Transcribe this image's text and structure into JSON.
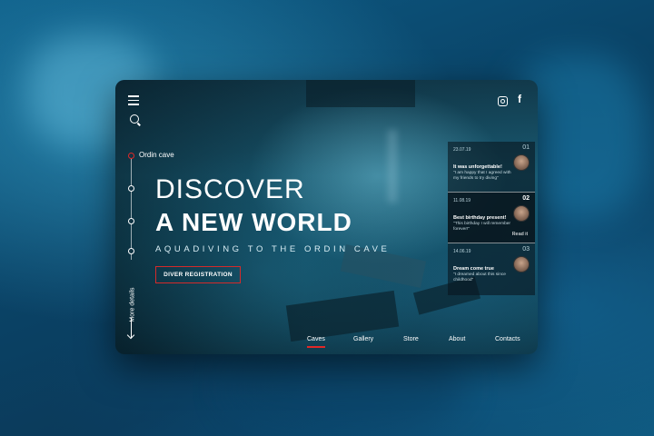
{
  "header": {
    "menu_icon": "hamburger-icon",
    "search_icon": "search-icon",
    "social": [
      "instagram-icon",
      "facebook-icon"
    ],
    "facebook_glyph": "f"
  },
  "timeline": {
    "active_label": "Ordin cave",
    "steps": 4
  },
  "side": {
    "more_label": "More details"
  },
  "hero": {
    "line1": "DISCOVER",
    "line2": "A NEW WORLD",
    "subtitle": "AQUADIVING TO THE ORDIN CAVE",
    "cta_label": "DIVER REGISTRATION"
  },
  "nav": {
    "items": [
      "Caves",
      "Gallery",
      "Store",
      "About",
      "Contacts"
    ],
    "active": "Caves"
  },
  "reviews": [
    {
      "date": "23.07.19",
      "number": "01",
      "title": "It was unforgettable!",
      "body": "\"I am happy that I agreed with my friends to try diving\""
    },
    {
      "date": "11.08.19",
      "number": "02",
      "title": "Best birthday present!",
      "body": "\"This birthday I will remember forever!\"",
      "link": "Read it"
    },
    {
      "date": "14.06.19",
      "number": "03",
      "title": "Dream come true",
      "body": "\"I dreamed about this since childhood\""
    }
  ],
  "colors": {
    "accent": "#e02828",
    "panel": "#0c3242"
  }
}
